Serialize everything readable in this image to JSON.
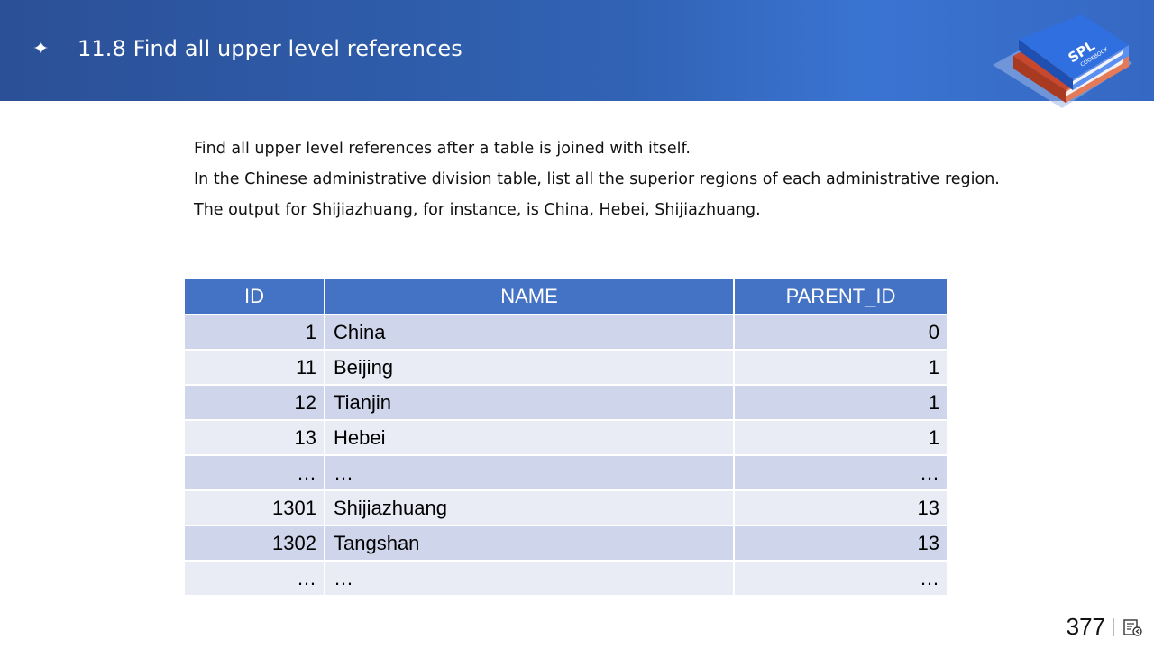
{
  "header": {
    "bullet_icon": "four-point-star-icon",
    "title": "11.8 Find all upper level references",
    "logo": {
      "line1": "SPL",
      "line2": "COOKBOOK"
    },
    "colors": {
      "band": "#3163b5",
      "book_blue": "#2f6fe0",
      "book_red": "#d9542f"
    }
  },
  "description": [
    "Find all upper level references after a table is joined with itself.",
    "In the Chinese administrative division table, list all the superior regions of each administrative region.",
    "The output for Shijiazhuang, for instance, is China, Hebei, Shijiazhuang."
  ],
  "table": {
    "header_color": "#4472c4",
    "row_colors": [
      "#cfd5ea",
      "#e9ebf5"
    ],
    "columns": [
      "ID",
      "NAME",
      "PARENT_ID"
    ],
    "rows": [
      [
        "1",
        "China",
        "0"
      ],
      [
        "11",
        "Beijing",
        "1"
      ],
      [
        "12",
        "Tianjin",
        "1"
      ],
      [
        "13",
        "Hebei",
        "1"
      ],
      [
        "…",
        "…",
        "…"
      ],
      [
        "1301",
        "Shijiazhuang",
        "13"
      ],
      [
        "1302",
        "Tangshan",
        "13"
      ],
      [
        "…",
        "…",
        "…"
      ]
    ]
  },
  "footer": {
    "page_number": "377",
    "nav_icon": "slide-navigation-icon"
  }
}
